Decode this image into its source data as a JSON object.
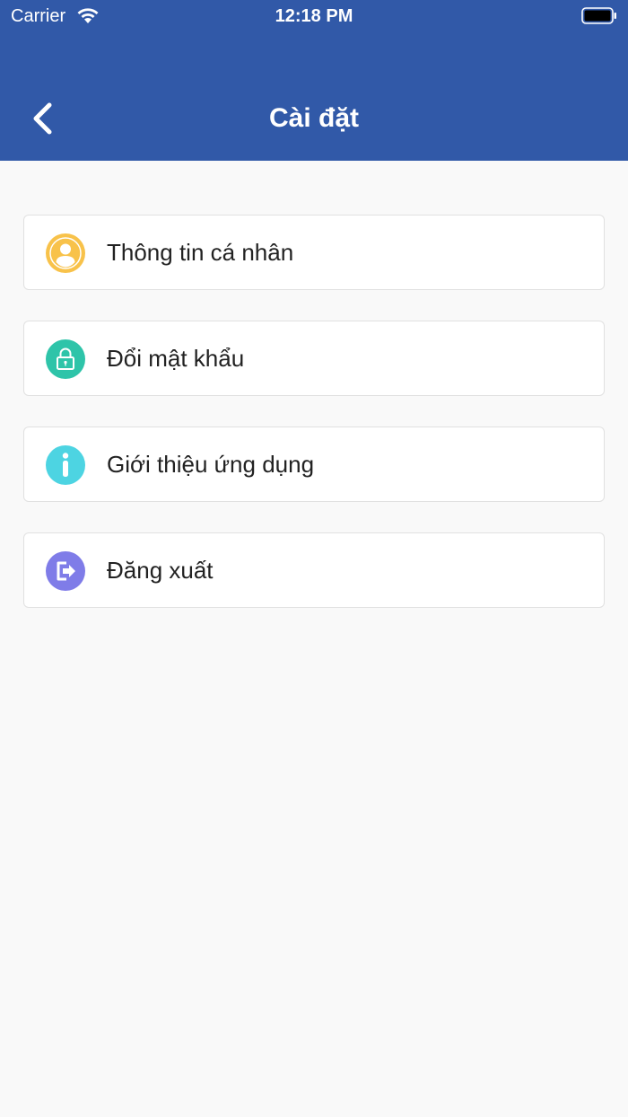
{
  "status_bar": {
    "carrier": "Carrier",
    "time": "12:18 PM"
  },
  "header": {
    "title": "Cài đặt",
    "background": "#3159a8"
  },
  "menu": {
    "items": [
      {
        "label": "Thông tin cá nhân",
        "icon": "user-icon",
        "color": "#f8c24a"
      },
      {
        "label": "Đổi mật khẩu",
        "icon": "lock-icon",
        "color": "#2ec4a9"
      },
      {
        "label": "Giới thiệu ứng dụng",
        "icon": "info-icon",
        "color": "#4dd4e2"
      },
      {
        "label": "Đăng xuất",
        "icon": "logout-icon",
        "color": "#7f7ce8"
      }
    ]
  }
}
